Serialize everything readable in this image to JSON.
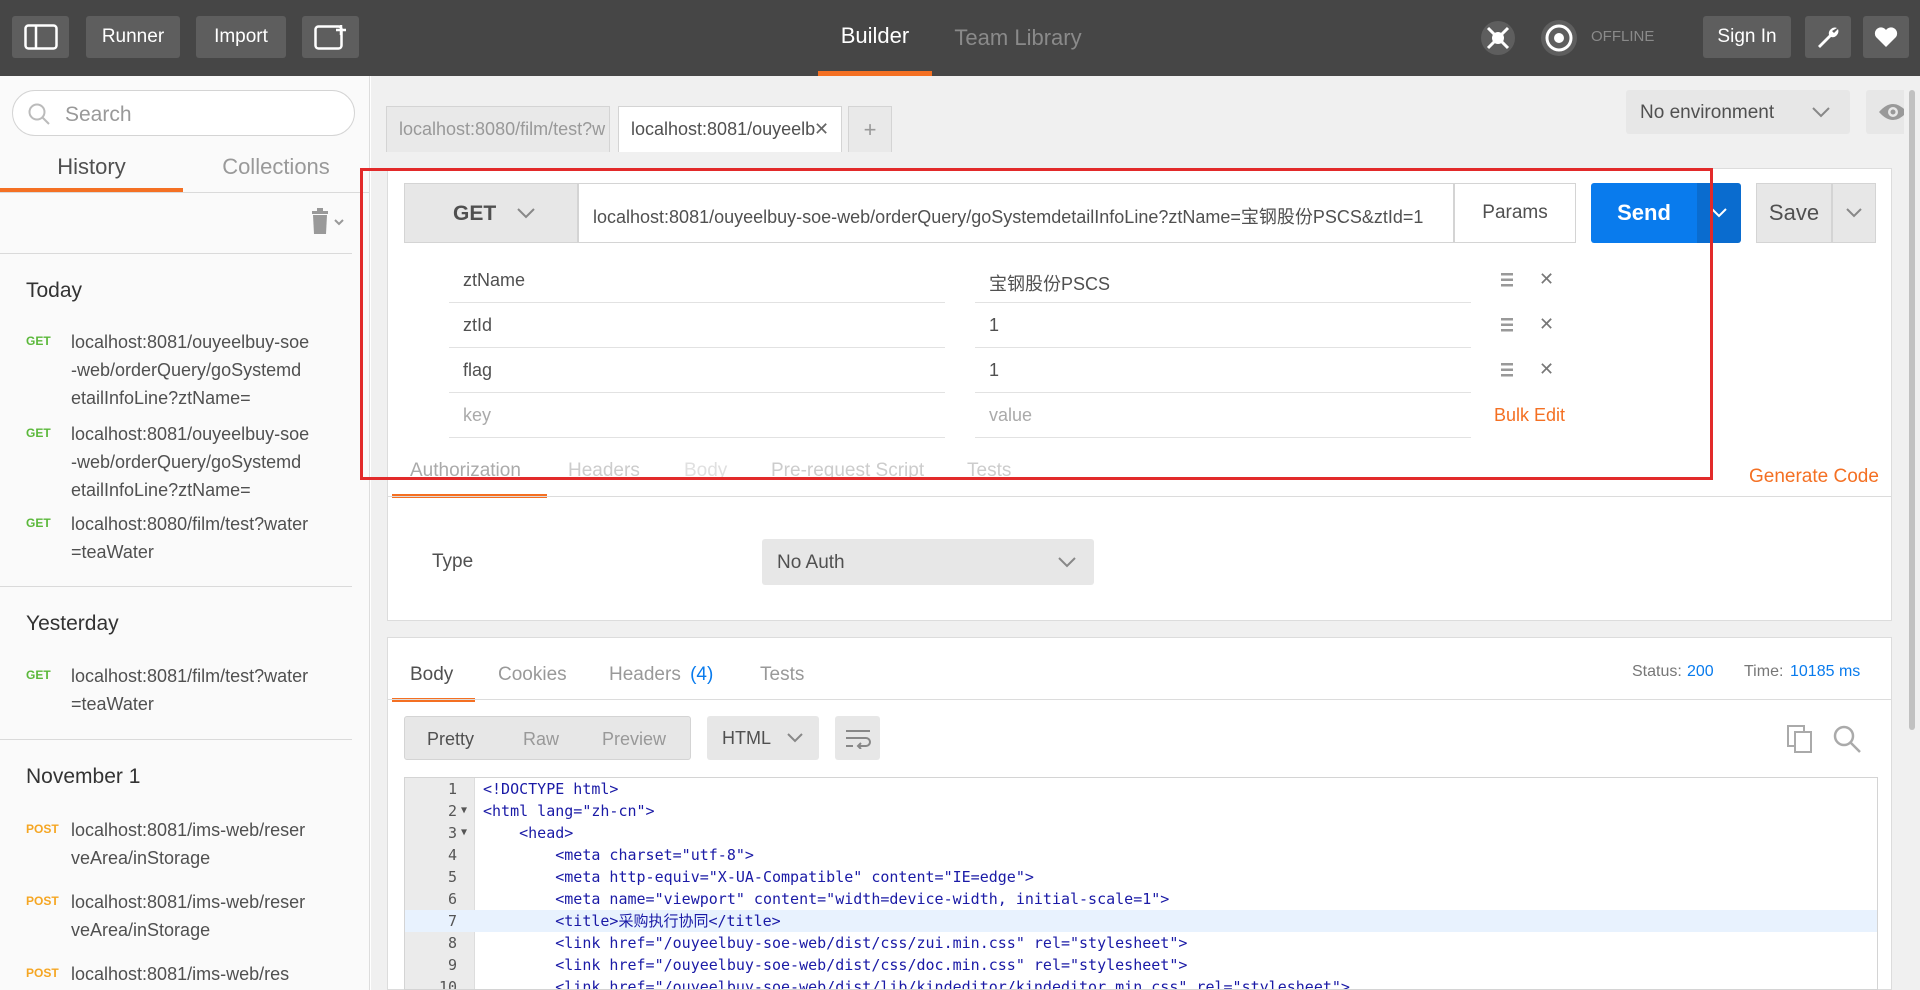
{
  "toolbar": {
    "runner": "Runner",
    "import": "Import",
    "builder": "Builder",
    "team_library": "Team Library",
    "offline": "OFFLINE",
    "sign_in": "Sign In"
  },
  "sidebar": {
    "search_placeholder": "Search",
    "tabs": [
      "History",
      "Collections"
    ],
    "groups": [
      {
        "title": "Today",
        "items": [
          {
            "method": "GET",
            "url": "localhost:8081/ouyeelbuy-soe-web/orderQuery/goSystemdetailInfoLine?ztName="
          },
          {
            "method": "GET",
            "url": "localhost:8081/ouyeelbuy-soe-web/orderQuery/goSystemdetailInfoLine?ztName="
          },
          {
            "method": "GET",
            "url": "localhost:8080/film/test?water=teaWater"
          }
        ]
      },
      {
        "title": "Yesterday",
        "items": [
          {
            "method": "GET",
            "url": "localhost:8081/film/test?water=teaWater"
          }
        ]
      },
      {
        "title": "November 1",
        "items": [
          {
            "method": "POST",
            "url": "localhost:8081/ims-web/reserveArea/inStorage"
          },
          {
            "method": "POST",
            "url": "localhost:8081/ims-web/reserveArea/inStorage"
          },
          {
            "method": "POST",
            "url": "localhost:8081/ims-web/res"
          }
        ]
      }
    ]
  },
  "tabs": [
    {
      "label": "localhost:8080/film/test?w"
    },
    {
      "label": "localhost:8081/ouyeelb"
    }
  ],
  "environment": "No environment",
  "request": {
    "method": "GET",
    "url": "localhost:8081/ouyeelbuy-soe-web/orderQuery/goSystemdetailInfoLine?ztName=宝钢股份PSCS&ztId=1",
    "params_label": "Params",
    "send_label": "Send",
    "save_label": "Save",
    "params": [
      {
        "key": "ztName",
        "value": "宝钢股份PSCS"
      },
      {
        "key": "ztId",
        "value": "1"
      },
      {
        "key": "flag",
        "value": "1"
      }
    ],
    "key_placeholder": "key",
    "value_placeholder": "value",
    "bulk_edit": "Bulk Edit",
    "subtabs": [
      "Authorization",
      "Headers",
      "Body",
      "Pre-request Script",
      "Tests"
    ],
    "generate_code": "Generate Code",
    "auth_type_label": "Type",
    "auth_type": "No Auth"
  },
  "response": {
    "tabs": [
      "Body",
      "Cookies",
      "Headers",
      "Tests"
    ],
    "headers_count": "(4)",
    "status_label": "Status:",
    "status": "200",
    "time_label": "Time:",
    "time": "10185 ms",
    "view_modes": [
      "Pretty",
      "Raw",
      "Preview"
    ],
    "format": "HTML",
    "lines": [
      {
        "n": "1",
        "text": "<!DOCTYPE html>"
      },
      {
        "n": "2",
        "text": "<html lang=\"zh-cn\">"
      },
      {
        "n": "3",
        "text": "    <head>"
      },
      {
        "n": "4",
        "text": "        <meta charset=\"utf-8\">"
      },
      {
        "n": "5",
        "text": "        <meta http-equiv=\"X-UA-Compatible\" content=\"IE=edge\">"
      },
      {
        "n": "6",
        "text": "        <meta name=\"viewport\" content=\"width=device-width, initial-scale=1\">"
      },
      {
        "n": "7",
        "text": "        <title>采购执行协同</title>"
      },
      {
        "n": "8",
        "text": "        <link href=\"/ouyeelbuy-soe-web/dist/css/zui.min.css\" rel=\"stylesheet\">"
      },
      {
        "n": "9",
        "text": "        <link href=\"/ouyeelbuy-soe-web/dist/css/doc.min.css\" rel=\"stylesheet\">"
      },
      {
        "n": "10",
        "text": "        <link href=\"/ouyeelbuy-soe-web/dist/lib/kindeditor/kindeditor.min.css\" rel=\"stylesheet\">"
      }
    ]
  },
  "colors": {
    "accent": "#f47023",
    "send": "#097bed",
    "get": "#5bb83b",
    "post": "#f5a623",
    "highlight_box": "#e22a2a"
  }
}
